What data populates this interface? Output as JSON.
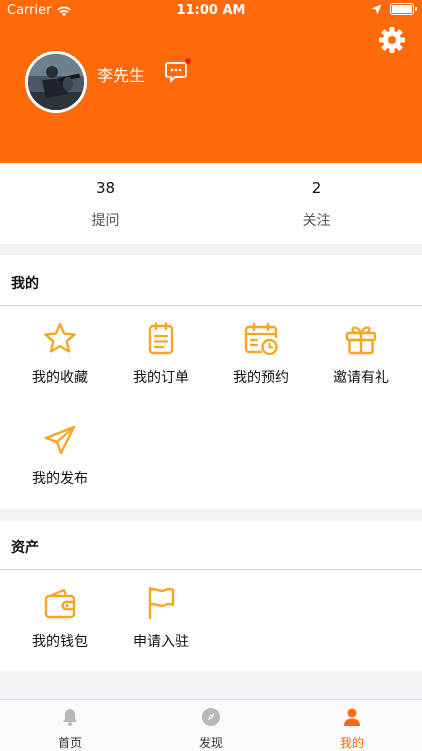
{
  "status_bar": {
    "carrier": "Carrier",
    "time": "11:00 AM",
    "battery_level": 1.0
  },
  "profile": {
    "name": "李先生"
  },
  "stats": [
    {
      "value": "38",
      "label": "提问"
    },
    {
      "value": "2",
      "label": "关注"
    }
  ],
  "sections": {
    "mine": {
      "title": "我的",
      "items": [
        {
          "label": "我的收藏",
          "icon": "star-icon"
        },
        {
          "label": "我的订单",
          "icon": "clipboard-icon"
        },
        {
          "label": "我的预约",
          "icon": "calendar-clock-icon"
        },
        {
          "label": "邀请有礼",
          "icon": "gift-icon"
        },
        {
          "label": "我的发布",
          "icon": "paper-plane-icon"
        }
      ]
    },
    "assets": {
      "title": "资产",
      "items": [
        {
          "label": "我的钱包",
          "icon": "wallet-icon"
        },
        {
          "label": "申请入驻",
          "icon": "flag-icon"
        }
      ]
    }
  },
  "tabbar": [
    {
      "label": "首页",
      "icon": "bell-icon",
      "active": false
    },
    {
      "label": "发现",
      "icon": "compass-icon",
      "active": false
    },
    {
      "label": "我的",
      "icon": "person-icon",
      "active": true
    }
  ],
  "colors": {
    "accent": "#ff6a0b",
    "icon": "#f5a623",
    "inactive_tab": "#b8b8b8"
  }
}
